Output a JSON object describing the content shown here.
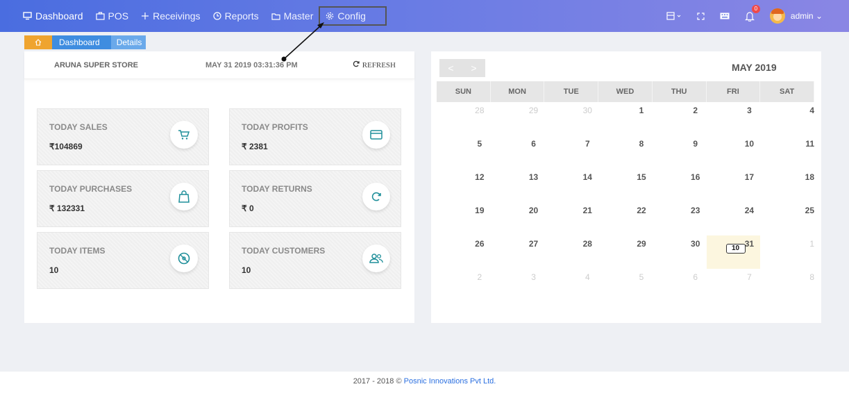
{
  "nav": {
    "items": [
      {
        "label": "Dashboard",
        "icon": "monitor-icon"
      },
      {
        "label": "POS",
        "icon": "briefcase-icon"
      },
      {
        "label": "Receivings",
        "icon": "plus-icon"
      },
      {
        "label": "Reports",
        "icon": "clock-icon"
      },
      {
        "label": "Master",
        "icon": "folder-icon"
      },
      {
        "label": "Config",
        "icon": "gear-icon"
      }
    ],
    "notification_count": "0",
    "user": "admin"
  },
  "breadcrumb": {
    "home_icon": "home-icon",
    "items": [
      "Dashboard",
      "Details"
    ]
  },
  "summary": {
    "store": "ARUNA SUPER STORE",
    "datetime": "MAY 31 2019 03:31:36 PM",
    "refresh": "REFRESH"
  },
  "cards": [
    {
      "title": "TODAY SALES",
      "value": "₹104869",
      "icon": "cart-icon"
    },
    {
      "title": "TODAY PROFITS",
      "value": "₹ 2381",
      "icon": "credit-card-icon"
    },
    {
      "title": "TODAY PURCHASES",
      "value": "₹ 132331",
      "icon": "shopping-bag-icon"
    },
    {
      "title": "TODAY RETURNS",
      "value": "₹ 0",
      "icon": "refresh-icon"
    },
    {
      "title": "TODAY ITEMS",
      "value": "10",
      "icon": "disc-icon"
    },
    {
      "title": "TODAY CUSTOMERS",
      "value": "10",
      "icon": "users-icon"
    }
  ],
  "calendar": {
    "title": "MAY 2019",
    "prev": "<",
    "next": ">",
    "weekdays": [
      "SUN",
      "MON",
      "TUE",
      "WED",
      "THU",
      "FRI",
      "SAT"
    ],
    "weeks": [
      [
        "28",
        "29",
        "30",
        "1",
        "2",
        "3",
        "4"
      ],
      [
        "5",
        "6",
        "7",
        "8",
        "9",
        "10",
        "11"
      ],
      [
        "12",
        "13",
        "14",
        "15",
        "16",
        "17",
        "18"
      ],
      [
        "19",
        "20",
        "21",
        "22",
        "23",
        "24",
        "25"
      ],
      [
        "26",
        "27",
        "28",
        "29",
        "30",
        "31",
        "1"
      ],
      [
        "2",
        "3",
        "4",
        "5",
        "6",
        "7",
        "8"
      ]
    ],
    "today": "31",
    "today_event_count": "10"
  },
  "footer": {
    "text": "2017 - 2018 © ",
    "link": "Posnic Innovations Pvt Ltd."
  }
}
